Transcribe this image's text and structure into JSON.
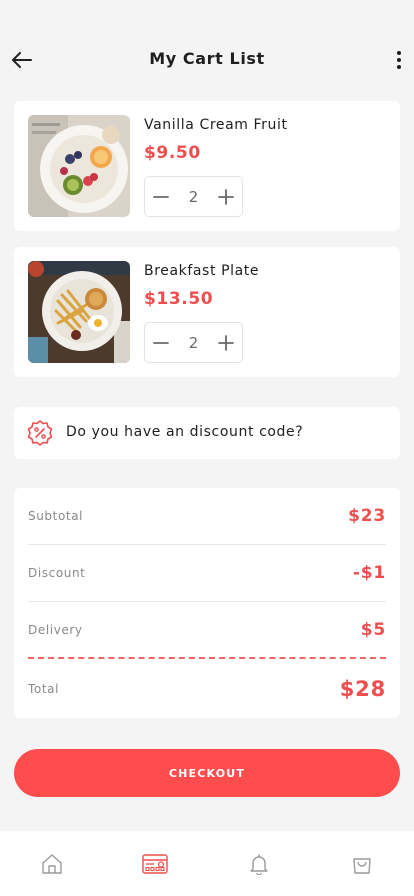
{
  "header": {
    "title": "My Cart List",
    "back_icon": "arrow-left-icon",
    "more_icon": "more-vertical-icon"
  },
  "cart": {
    "items": [
      {
        "name": "Vanilla Cream Fruit",
        "price": "$9.50",
        "quantity": "2",
        "image": "fruit-bowl-photo"
      },
      {
        "name": "Breakfast Plate",
        "price": "$13.50",
        "quantity": "2",
        "image": "breakfast-plate-photo"
      }
    ]
  },
  "discount": {
    "text": "Do you have an discount code?",
    "icon": "discount-badge-icon"
  },
  "summary": {
    "subtotal_label": "Subtotal",
    "subtotal_value": "$23",
    "discount_label": "Discount",
    "discount_value": "-$1",
    "delivery_label": "Delivery",
    "delivery_value": "$5",
    "total_label": "Total",
    "total_value": "$28"
  },
  "checkout_label": "CHECKOUT",
  "nav": {
    "items": [
      {
        "icon": "home-icon",
        "active": false
      },
      {
        "icon": "payment-card-icon",
        "active": true
      },
      {
        "icon": "bell-icon",
        "active": false
      },
      {
        "icon": "shopping-bag-icon",
        "active": false
      }
    ]
  },
  "colors": {
    "accent": "#f04e4e",
    "button": "#ff4d4d",
    "background": "#f4f4f4",
    "text": "#1f1f1f"
  }
}
